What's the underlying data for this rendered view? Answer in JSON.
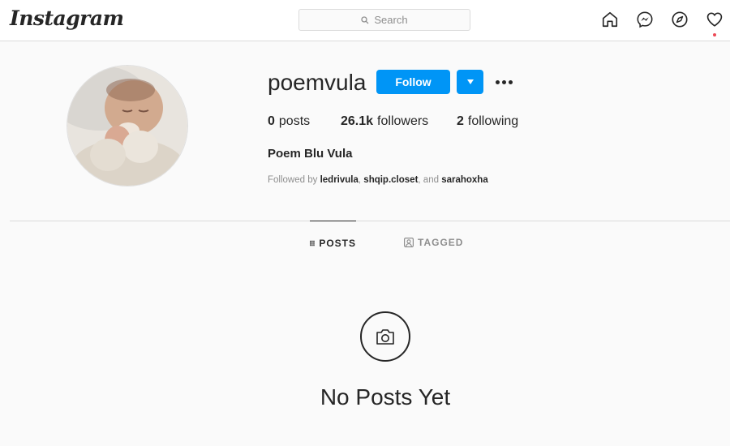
{
  "nav": {
    "logo": "Instagram",
    "search_placeholder": "Search",
    "icons": [
      "home-icon",
      "messenger-icon",
      "explore-icon",
      "activity-heart-icon"
    ]
  },
  "profile": {
    "username": "poemvula",
    "follow_label": "Follow",
    "stats": {
      "posts_count": "0",
      "posts_label": "posts",
      "followers_count": "26.1k",
      "followers_label": "followers",
      "following_count": "2",
      "following_label": "following"
    },
    "full_name": "Poem Blu Vula",
    "followed_by": {
      "prefix": "Followed by",
      "users": [
        "ledrivula",
        "shqip.closet",
        "sarahoxha"
      ],
      "separator1": ",",
      "separator2": ", and"
    }
  },
  "tabs": [
    {
      "label": "POSTS",
      "active": true
    },
    {
      "label": "TAGGED",
      "active": false
    }
  ],
  "empty_state": {
    "message": "No Posts Yet"
  },
  "colors": {
    "accent": "#0095f6",
    "text": "#262626",
    "muted": "#8e8e8e",
    "border": "#dbdbdb",
    "notification": "#ed4956"
  }
}
